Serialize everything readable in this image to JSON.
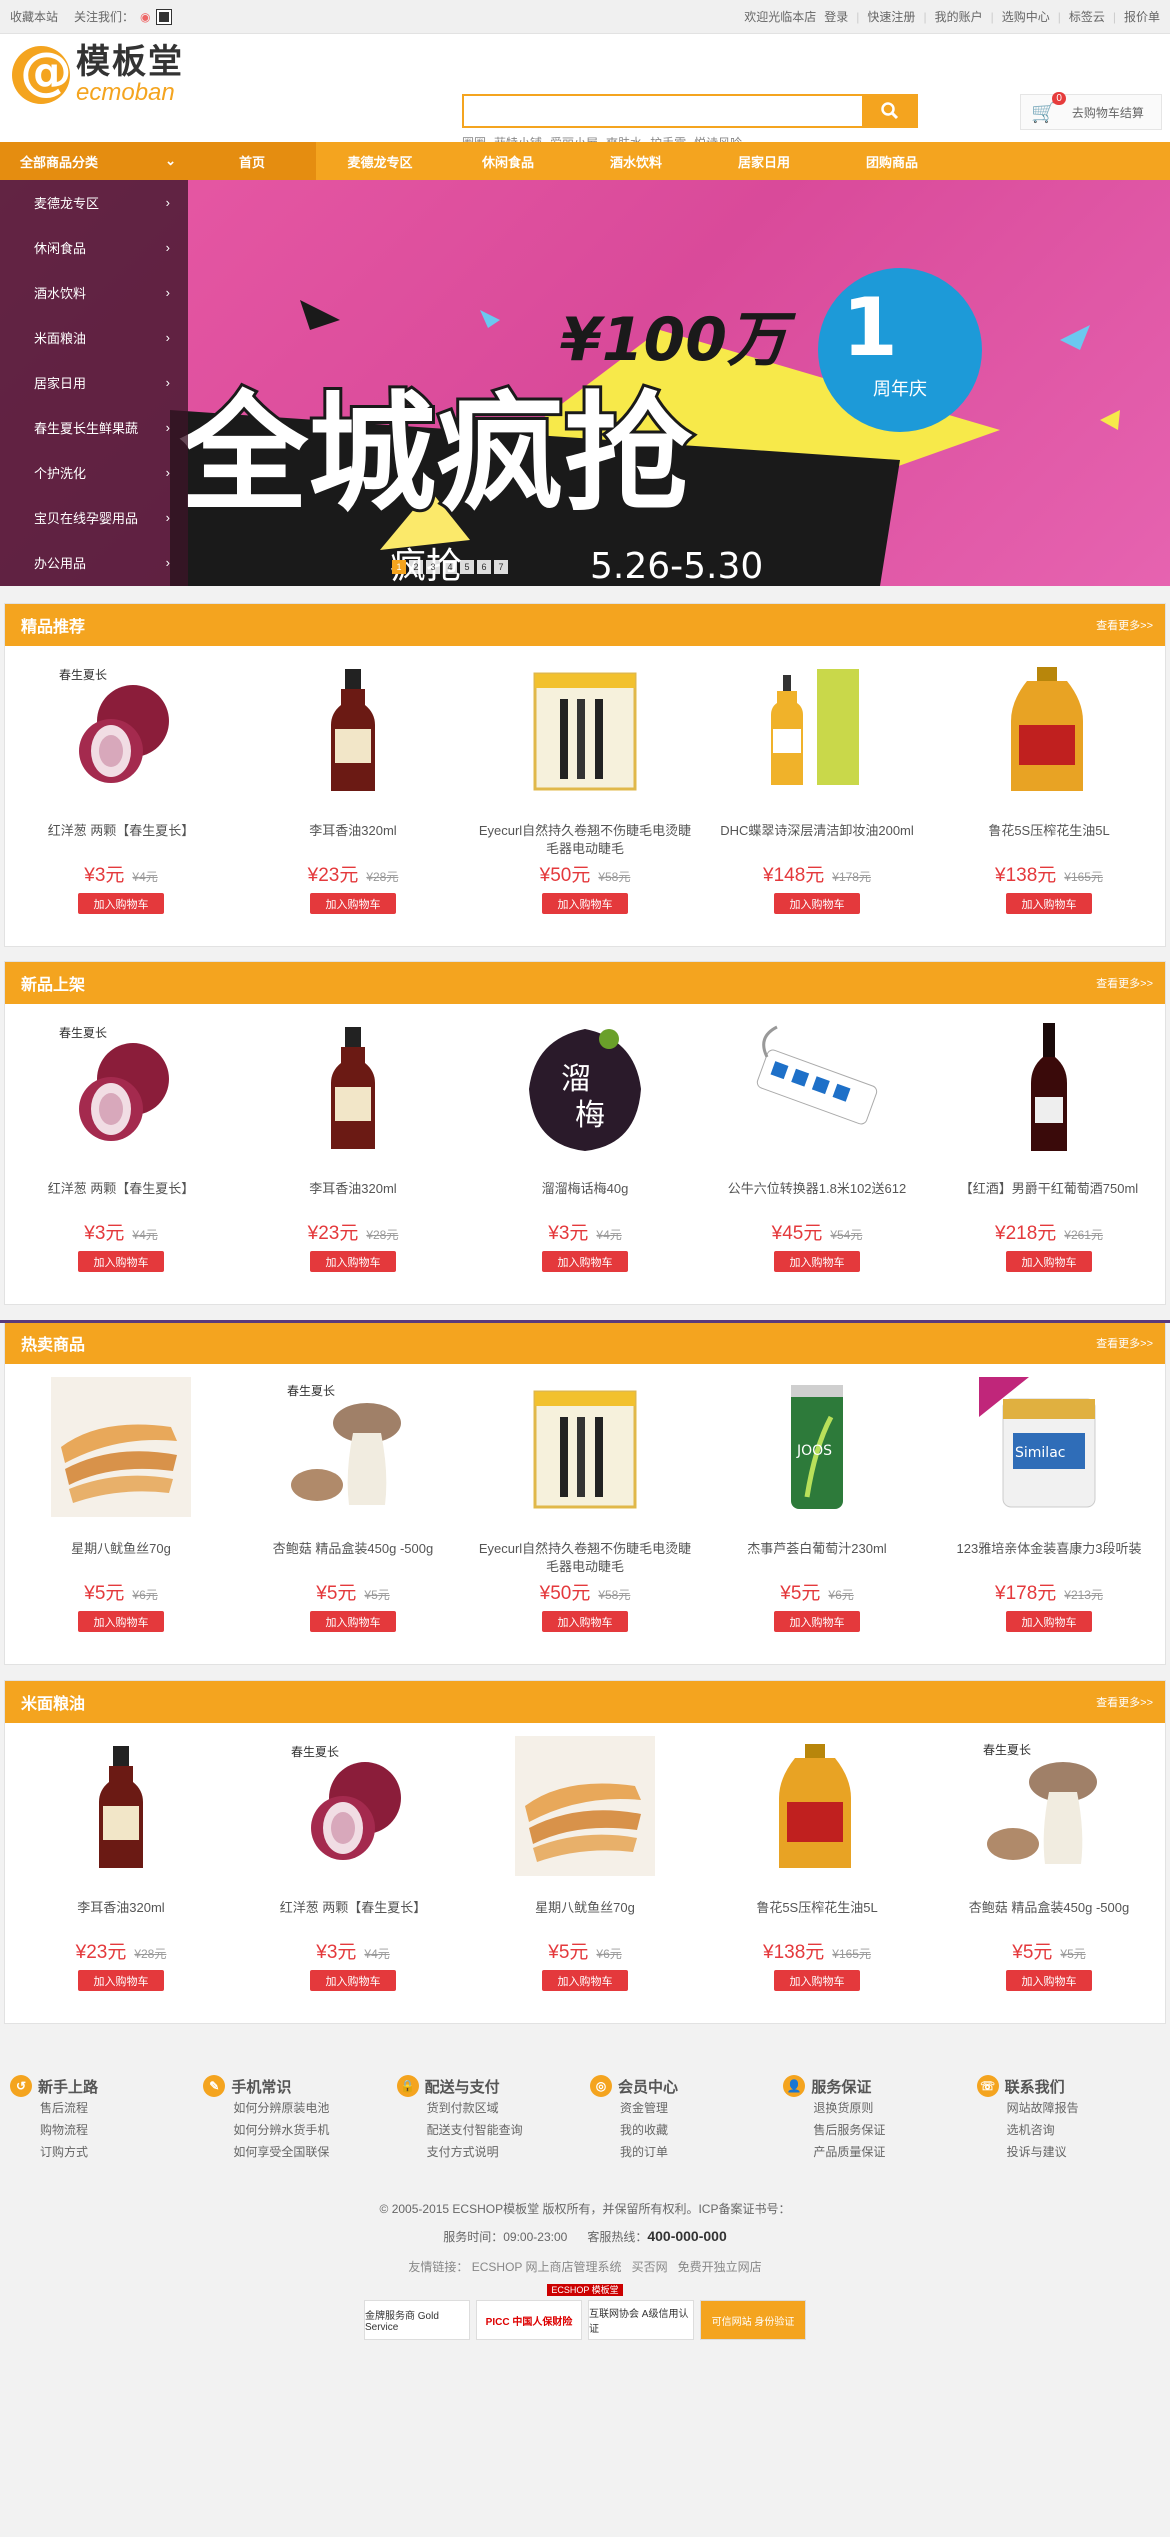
{
  "topbar": {
    "left": [
      "收藏本站",
      "关注我们："
    ],
    "right": [
      "欢迎光临本店",
      "登录",
      "快速注册",
      "我的账户",
      "选购中心",
      "标签云",
      "报价单"
    ]
  },
  "logo": {
    "cn": "模板堂",
    "en": "ecmoban"
  },
  "search": {
    "hotwords": [
      "圈圈",
      "菲特小铺",
      "爱丽小屋",
      "爽肤水",
      "护手霜",
      "悦诗风吟"
    ],
    "button_icon": "search-icon"
  },
  "cart": {
    "count": "0",
    "label": "去购物车结算"
  },
  "nav": {
    "category": "全部商品分类",
    "items": [
      "首页",
      "麦德龙专区",
      "休闲食品",
      "酒水饮料",
      "居家日用",
      "团购商品"
    ]
  },
  "side_menu": [
    "麦德龙专区",
    "休闲食品",
    "酒水饮料",
    "米面粮油",
    "居家日用",
    "春生夏长生鲜果蔬",
    "个护洗化",
    "宝贝在线孕婴用品",
    "办公用品"
  ],
  "banner": {
    "price": "¥100万",
    "headline": "全城疯抢",
    "anniv": "周年庆",
    "date": "5.26-5.30",
    "sub": "疯抢",
    "dots": [
      "1",
      "2",
      "3",
      "4",
      "5",
      "6",
      "7"
    ]
  },
  "floors": [
    {
      "title": "精品推荐",
      "more": "查看更多>>",
      "products": [
        {
          "name": "红洋葱 两颗【春生夏长】",
          "price": "¥3元",
          "old": "¥4元",
          "img": "onion"
        },
        {
          "name": "李耳香油320ml",
          "price": "¥23元",
          "old": "¥28元",
          "img": "oil-bottle"
        },
        {
          "name": "Eyecurl自然持久卷翘不伤睫毛电烫睫毛器电动睫毛",
          "price": "¥50元",
          "old": "¥58元",
          "img": "curler"
        },
        {
          "name": "DHC蝶翠诗深层清洁卸妆油200ml",
          "price": "¥148元",
          "old": "¥178元",
          "img": "dhc"
        },
        {
          "name": "鲁花5S压榨花生油5L",
          "price": "¥138元",
          "old": "¥165元",
          "img": "peanut-oil"
        }
      ]
    },
    {
      "title": "新品上架",
      "more": "查看更多>>",
      "products": [
        {
          "name": "红洋葱 两颗【春生夏长】",
          "price": "¥3元",
          "old": "¥4元",
          "img": "onion"
        },
        {
          "name": "李耳香油320ml",
          "price": "¥23元",
          "old": "¥28元",
          "img": "oil-bottle"
        },
        {
          "name": "溜溜梅话梅40g",
          "price": "¥3元",
          "old": "¥4元",
          "img": "plum"
        },
        {
          "name": "公牛六位转换器1.8米102送612",
          "price": "¥45元",
          "old": "¥54元",
          "img": "socket"
        },
        {
          "name": "【红酒】男爵干红葡萄酒750ml",
          "price": "¥218元",
          "old": "¥261元",
          "img": "wine"
        }
      ]
    },
    {
      "title": "热卖商品",
      "more": "查看更多>>",
      "products": [
        {
          "name": "星期八鱿鱼丝70g",
          "price": "¥5元",
          "old": "¥6元",
          "img": "squid"
        },
        {
          "name": "杏鲍菇 精品盒装450g -500g",
          "price": "¥5元",
          "old": "¥5元",
          "img": "mushroom"
        },
        {
          "name": "Eyecurl自然持久卷翘不伤睫毛电烫睫毛器电动睫毛",
          "price": "¥50元",
          "old": "¥58元",
          "img": "curler"
        },
        {
          "name": "杰事芦荟白葡萄汁230ml",
          "price": "¥5元",
          "old": "¥6元",
          "img": "aloe"
        },
        {
          "name": "123雅培亲体金装喜康力3段听装",
          "price": "¥178元",
          "old": "¥213元",
          "img": "milk"
        }
      ]
    },
    {
      "title": "米面粮油",
      "more": "查看更多>>",
      "products": [
        {
          "name": "李耳香油320ml",
          "price": "¥23元",
          "old": "¥28元",
          "img": "oil-bottle"
        },
        {
          "name": "红洋葱 两颗【春生夏长】",
          "price": "¥3元",
          "old": "¥4元",
          "img": "onion"
        },
        {
          "name": "星期八鱿鱼丝70g",
          "price": "¥5元",
          "old": "¥6元",
          "img": "squid"
        },
        {
          "name": "鲁花5S压榨花生油5L",
          "price": "¥138元",
          "old": "¥165元",
          "img": "peanut-oil"
        },
        {
          "name": "杏鲍菇 精品盒装450g -500g",
          "price": "¥5元",
          "old": "¥5元",
          "img": "mushroom"
        }
      ]
    }
  ],
  "add_cart_label": "加入购物车",
  "help": [
    {
      "title": "新手上路",
      "links": [
        "售后流程",
        "购物流程",
        "订购方式"
      ]
    },
    {
      "title": "手机常识",
      "links": [
        "如何分辨原装电池",
        "如何分辨水货手机",
        "如何享受全国联保"
      ]
    },
    {
      "title": "配送与支付",
      "links": [
        "货到付款区域",
        "配送支付智能查询",
        "支付方式说明"
      ]
    },
    {
      "title": "会员中心",
      "links": [
        "资金管理",
        "我的收藏",
        "我的订单"
      ]
    },
    {
      "title": "服务保证",
      "links": [
        "退换货原则",
        "售后服务保证",
        "产品质量保证"
      ]
    },
    {
      "title": "联系我们",
      "links": [
        "网站故障报告",
        "选机咨询",
        "投诉与建议"
      ]
    }
  ],
  "footer": {
    "copyright": "© 2005-2015 ECSHOP模板堂 版权所有，并保留所有权利。ICP备案证书号：",
    "service_time": "服务时间：09:00-23:00",
    "hotline_label": "客服热线：",
    "hotline": "400-000-000",
    "links_label": "友情链接：",
    "links": [
      "ECSHOP 网上商店管理系统",
      "买否网",
      "免费开独立网店"
    ],
    "powered": "ECSHOP 模板堂",
    "badges": [
      "金牌服务商 Gold Service",
      "PICC 中国人保财险",
      "互联网协会 A级信用认证",
      "可信网站 身份验证"
    ]
  },
  "colors": {
    "accent": "#f4a41f",
    "price": "#e4393c"
  }
}
